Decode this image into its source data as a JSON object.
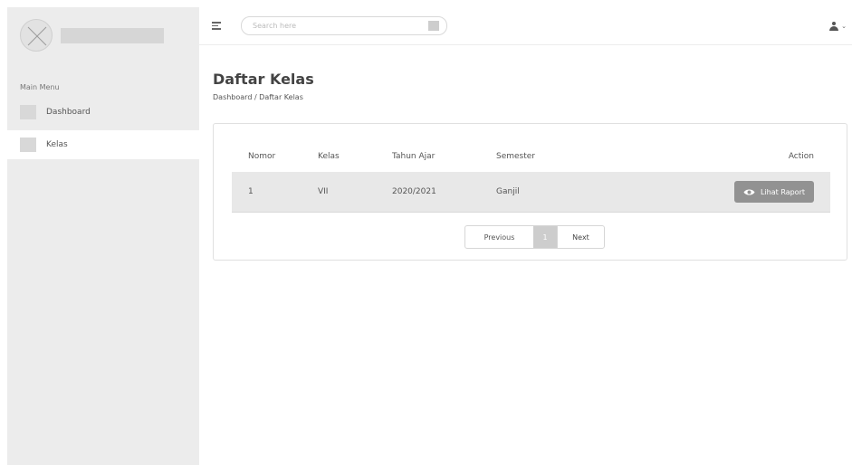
{
  "sidebar": {
    "menu_title": "Main Menu",
    "items": [
      {
        "label": "Dashboard",
        "active": false
      },
      {
        "label": "Kelas",
        "active": true
      }
    ]
  },
  "topbar": {
    "search_placeholder": "Search here",
    "user_chevron": "⌄"
  },
  "page": {
    "title": "Daftar Kelas",
    "breadcrumb": "Dashboard / Daftar Kelas"
  },
  "table": {
    "headers": [
      "Nomor",
      "Kelas",
      "Tahun Ajar",
      "Semester",
      "Action"
    ],
    "rows": [
      {
        "nomor": "1",
        "kelas": "VII",
        "tahun_ajar": "2020/2021",
        "semester": "Ganjil",
        "action_label": "Lihat Raport"
      }
    ]
  },
  "pagination": {
    "previous": "Previous",
    "current": "1",
    "next": "Next"
  },
  "icons": {
    "logo": "placeholder-image-icon",
    "menu": "hamburger-icon",
    "search": "search-icon",
    "user": "user-icon",
    "view": "eye-icon"
  },
  "colors": {
    "sidebar_bg": "#ececec",
    "button_bg": "#929292",
    "row_bg": "#e8e8e8"
  }
}
